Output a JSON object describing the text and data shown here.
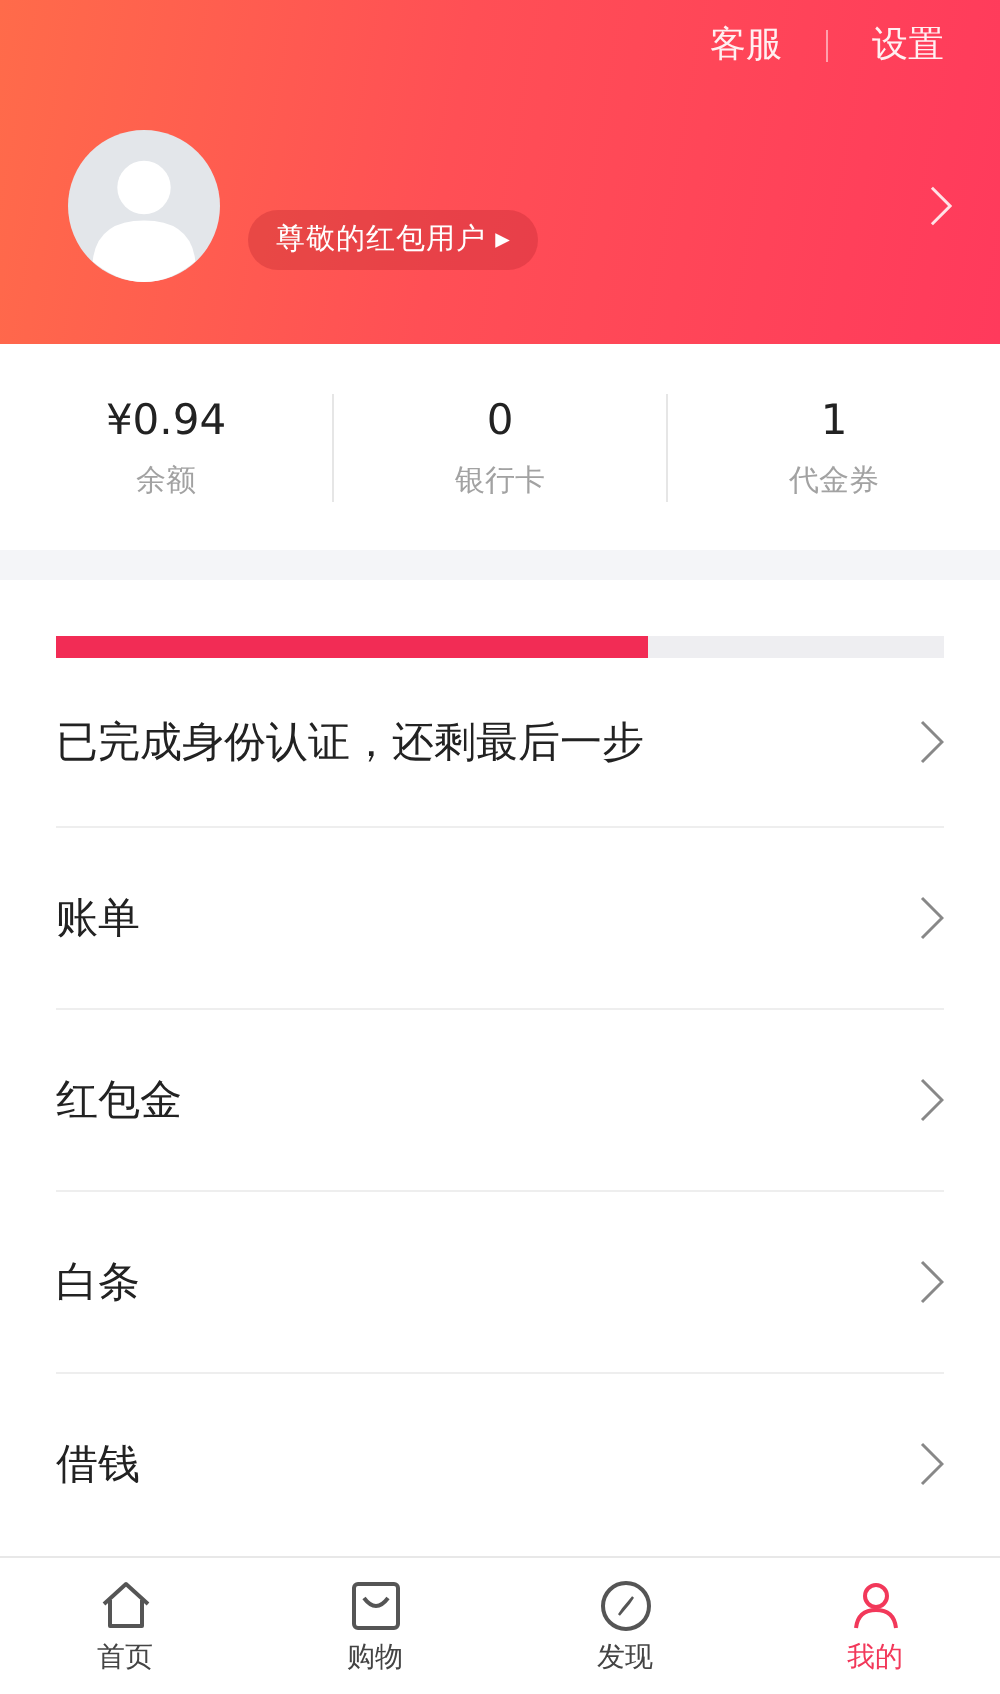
{
  "header": {
    "links": [
      "客服",
      "设置"
    ],
    "badge": "尊敬的红包用户 ▸"
  },
  "stats": [
    {
      "value": "¥0.94",
      "label": "余额"
    },
    {
      "value": "0",
      "label": "银行卡"
    },
    {
      "value": "1",
      "label": "代金券"
    }
  ],
  "verification": {
    "level": 0.667
  },
  "menu": [
    {
      "label": "已完成身份认证，还剩最后一步"
    },
    {
      "label": "账单"
    },
    {
      "label": "红包金"
    },
    {
      "label": "白条"
    },
    {
      "label": "借钱"
    }
  ],
  "tabs": [
    {
      "label": "首页",
      "kind": "home",
      "selected": false
    },
    {
      "label": "购物",
      "kind": "bag",
      "selected": false
    },
    {
      "label": "发现",
      "kind": "compass",
      "selected": false
    },
    {
      "label": "我的",
      "kind": "person",
      "selected": true
    }
  ]
}
